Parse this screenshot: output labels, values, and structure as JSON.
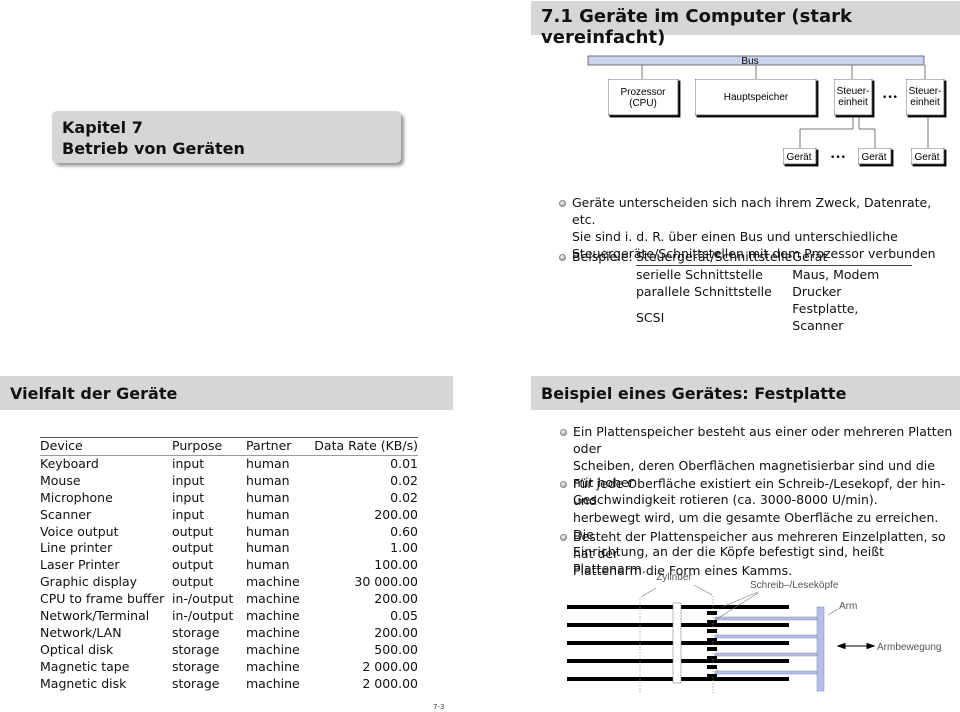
{
  "chapter": {
    "line1": "Kapitel 7",
    "line2": "Betrieb von Geräten"
  },
  "slide1": {
    "title": "7.1  Geräte im Computer (stark vereinfacht)",
    "diagram": {
      "bus_label": "Bus",
      "bus_color": "#c8d4f0",
      "boxes": {
        "cpu_line1": "Prozessor",
        "cpu_line2": "(CPU)",
        "memory": "Hauptspeicher",
        "ctrl1_line1": "Steuer-",
        "ctrl1_line2": "einheit",
        "ctrl2_line1": "Steuer-",
        "ctrl2_line2": "einheit",
        "device1": "Gerät",
        "device2": "Gerät",
        "device3": "Gerät"
      },
      "ellipsis": "•••"
    },
    "bullets": [
      {
        "lines": [
          "Geräte unterscheiden sich nach ihrem Zweck, Datenrate, etc.",
          "Sie sind i. d. R. über einen Bus und unterschiedliche",
          "Steuergeräte/Schnittstellen mit dem Prozessor verbunden"
        ]
      }
    ],
    "examples": {
      "label": "Beispiele:",
      "headers": [
        "Steuergerät/Schnittstelle",
        "Gerät"
      ],
      "rows": [
        [
          "serielle Schnittstelle",
          "Maus, Modem"
        ],
        [
          "parallele Schnittstelle",
          "Drucker"
        ],
        [
          "SCSI",
          "Festplatte, Scanner"
        ]
      ]
    }
  },
  "slide2": {
    "title": "Vielfalt der Geräte",
    "table": {
      "headers": [
        "Device",
        "Purpose",
        "Partner",
        "Data Rate (KB/s)"
      ],
      "rows": [
        [
          "Keyboard",
          "input",
          "human",
          "0.01"
        ],
        [
          "Mouse",
          "input",
          "human",
          "0.02"
        ],
        [
          "Microphone",
          "input",
          "human",
          "0.02"
        ],
        [
          "Scanner",
          "input",
          "human",
          "200.00"
        ],
        [
          "Voice output",
          "output",
          "human",
          "0.60"
        ],
        [
          "Line printer",
          "output",
          "human",
          "1.00"
        ],
        [
          "Laser Printer",
          "output",
          "human",
          "100.00"
        ],
        [
          "Graphic display",
          "output",
          "machine",
          "30 000.00"
        ],
        [
          "CPU to frame buffer",
          "in-/output",
          "machine",
          "200.00"
        ],
        [
          "Network/Terminal",
          "in-/output",
          "machine",
          "0.05"
        ],
        [
          "Network/LAN",
          "storage",
          "machine",
          "200.00"
        ],
        [
          "Optical disk",
          "storage",
          "machine",
          "500.00"
        ],
        [
          "Magnetic tape",
          "storage",
          "machine",
          "2 000.00"
        ],
        [
          "Magnetic disk",
          "storage",
          "machine",
          "2 000.00"
        ]
      ]
    }
  },
  "slide3": {
    "title": "Beispiel eines Gerätes: Festplatte",
    "bullets": [
      {
        "lines": [
          "Ein Plattenspeicher besteht aus einer oder mehreren Platten oder",
          "Scheiben, deren Oberflächen magnetisierbar sind und die mit hoher",
          "Geschwindigkeit rotieren (ca. 3000-8000 U/min)."
        ]
      },
      {
        "lines": [
          "Für jede Oberfläche existiert ein Schreib-/Lesekopf, der hin- und",
          "herbewegt wird, um die gesamte Oberfläche zu erreichen. Die",
          "Einrichtung, an der die Köpfe befestigt sind, heißt Plattenarm."
        ]
      },
      {
        "lines": [
          "Besteht der Plattenspeicher aus mehreren Einzelplatten, so hat der",
          "Plattenarm die Form eines Kamms."
        ]
      }
    ],
    "diagram": {
      "label_cylinder": "Zylinder",
      "label_heads": "Schreib–/Leseköpfe",
      "label_arm": "Arm",
      "label_motion": "Armbewegung",
      "arm_color": "#b4bee6"
    }
  },
  "footer": {
    "page_number": "7-3"
  }
}
